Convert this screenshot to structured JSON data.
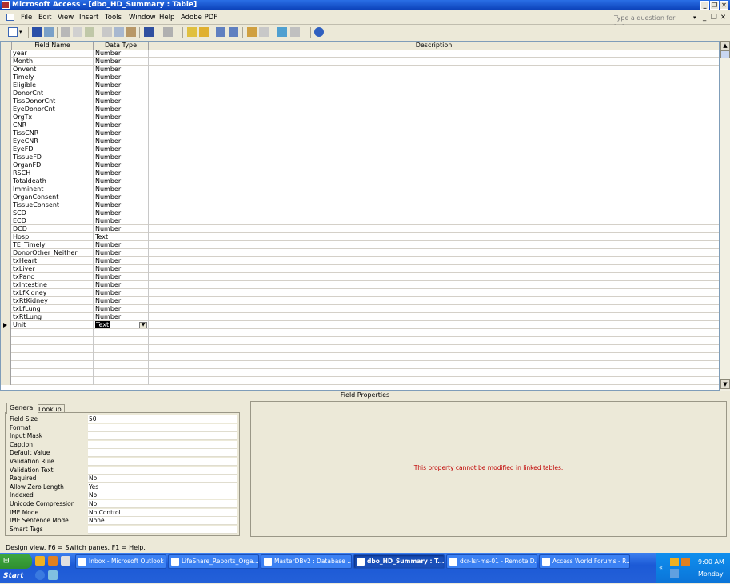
{
  "window": {
    "title": "Microsoft Access - [dbo_HD_Summary : Table]",
    "min_glyph": "_",
    "restore_glyph": "❐",
    "close_glyph": "✕"
  },
  "menu": {
    "items": [
      "File",
      "Edit",
      "View",
      "Insert",
      "Tools",
      "Window",
      "Help",
      "Adobe PDF"
    ],
    "help_placeholder": "Type a question for help"
  },
  "grid": {
    "headers": {
      "field_name": "Field Name",
      "data_type": "Data Type",
      "description": "Description"
    },
    "rows": [
      {
        "name": "year",
        "type": "Number"
      },
      {
        "name": "Month",
        "type": "Number"
      },
      {
        "name": "Onvent",
        "type": "Number"
      },
      {
        "name": "Timely",
        "type": "Number"
      },
      {
        "name": "Eligible",
        "type": "Number"
      },
      {
        "name": "DonorCnt",
        "type": "Number"
      },
      {
        "name": "TissDonorCnt",
        "type": "Number"
      },
      {
        "name": "EyeDonorCnt",
        "type": "Number"
      },
      {
        "name": "OrgTx",
        "type": "Number"
      },
      {
        "name": "CNR",
        "type": "Number"
      },
      {
        "name": "TissCNR",
        "type": "Number"
      },
      {
        "name": "EyeCNR",
        "type": "Number"
      },
      {
        "name": "EyeFD",
        "type": "Number"
      },
      {
        "name": "TissueFD",
        "type": "Number"
      },
      {
        "name": "OrganFD",
        "type": "Number"
      },
      {
        "name": "RSCH",
        "type": "Number"
      },
      {
        "name": "Totaldeath",
        "type": "Number"
      },
      {
        "name": "Imminent",
        "type": "Number"
      },
      {
        "name": "OrganConsent",
        "type": "Number"
      },
      {
        "name": "TissueConsent",
        "type": "Number"
      },
      {
        "name": "SCD",
        "type": "Number"
      },
      {
        "name": "ECD",
        "type": "Number"
      },
      {
        "name": "DCD",
        "type": "Number"
      },
      {
        "name": "Hosp",
        "type": "Text"
      },
      {
        "name": "TE_Timely",
        "type": "Number"
      },
      {
        "name": "DonorOther_Neither",
        "type": "Number"
      },
      {
        "name": "txHeart",
        "type": "Number"
      },
      {
        "name": "txLiver",
        "type": "Number"
      },
      {
        "name": "txPanc",
        "type": "Number"
      },
      {
        "name": "txIntestine",
        "type": "Number"
      },
      {
        "name": "txLfKidney",
        "type": "Number"
      },
      {
        "name": "txRtKidney",
        "type": "Number"
      },
      {
        "name": "txLfLung",
        "type": "Number"
      },
      {
        "name": "txRtLung",
        "type": "Number"
      },
      {
        "name": "Unit",
        "type": "Text"
      }
    ],
    "current_row_index": 34
  },
  "field_properties": {
    "label": "Field Properties",
    "tabs": [
      "General",
      "Lookup"
    ],
    "properties": [
      {
        "label": "Field Size",
        "value": "50"
      },
      {
        "label": "Format",
        "value": ""
      },
      {
        "label": "Input Mask",
        "value": ""
      },
      {
        "label": "Caption",
        "value": ""
      },
      {
        "label": "Default Value",
        "value": ""
      },
      {
        "label": "Validation Rule",
        "value": ""
      },
      {
        "label": "Validation Text",
        "value": ""
      },
      {
        "label": "Required",
        "value": "No"
      },
      {
        "label": "Allow Zero Length",
        "value": "Yes"
      },
      {
        "label": "Indexed",
        "value": "No"
      },
      {
        "label": "Unicode Compression",
        "value": "No"
      },
      {
        "label": "IME Mode",
        "value": "No Control"
      },
      {
        "label": "IME Sentence Mode",
        "value": "None"
      },
      {
        "label": "Smart Tags",
        "value": ""
      }
    ],
    "message": "This property cannot be modified in linked tables.",
    "message_color": "#c00000"
  },
  "status": {
    "text": "Design view.  F6 = Switch panes.  F1 = Help."
  },
  "taskbar": {
    "start_label": "Start",
    "tasks": [
      {
        "label": "Inbox - Microsoft Outlook",
        "active": false
      },
      {
        "label": "LifeShare_Reports_Orga...",
        "active": false
      },
      {
        "label": "MasterDBv2 : Database ...",
        "active": false
      },
      {
        "label": "dbo_HD_Summary : T...",
        "active": true
      },
      {
        "label": "dcr-lsr-ms-01 - Remote D...",
        "active": false
      },
      {
        "label": "Access World Forums - R...",
        "active": false
      }
    ],
    "clock": "9:00 AM",
    "day": "Monday"
  },
  "colors": {
    "title_bar": "#0a3fb7",
    "taskbar": "#2460d8",
    "start_button": "#3fa83f"
  }
}
